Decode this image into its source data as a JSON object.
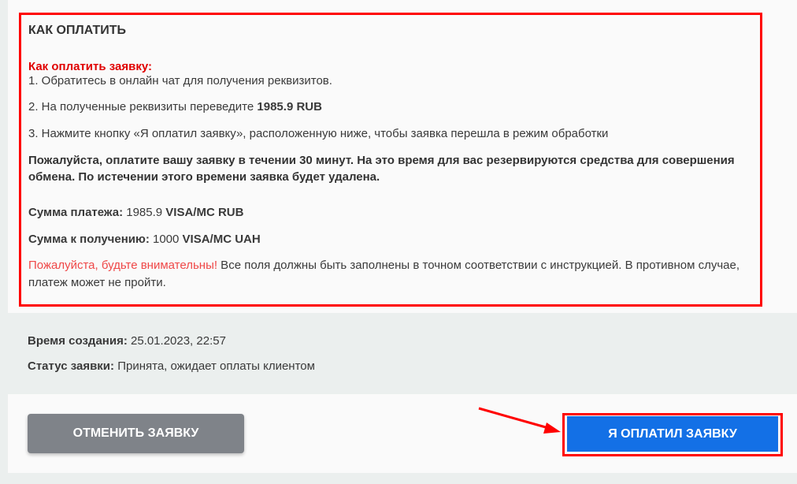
{
  "instructions": {
    "title": "КАК ОПЛАТИТЬ",
    "subtitle": "Как оплатить заявку:",
    "step1": "1. Обратитесь в онлайн чат для получения реквизитов.",
    "step2_prefix": "2. На полученные реквизиты переведите ",
    "step2_amount": "1985.9 RUB",
    "step3": "3. Нажмите кнопку «Я оплатил заявку», расположенную ниже, чтобы заявка перешла в режим обработки",
    "warning": "Пожалуйста, оплатите вашу заявку в течении 30 минут. На это время для вас резервируются средства для совершения обмена. По истечении этого времени заявка будет удалена.",
    "pay_label": "Сумма платежа:",
    "pay_amount": "1985.9",
    "pay_currency": "VISA/MC RUB",
    "receive_label": "Сумма к получению:",
    "receive_amount": "1000",
    "receive_currency": "VISA/MC UAH",
    "notice_red": "Пожалуйста, будьте внимательны!",
    "notice_text": " Все поля должны быть заполнены в точном соответствии с инструкцией. В противном случае, платеж может не пройти."
  },
  "meta": {
    "created_label": "Время создания:",
    "created_value": "25.01.2023, 22:57",
    "status_label": "Статус заявки:",
    "status_value": "Принята, ожидает оплаты клиентом"
  },
  "actions": {
    "cancel_label": "ОТМЕНИТЬ ЗАЯВКУ",
    "confirm_label": "Я ОПЛАТИЛ ЗАЯВКУ"
  },
  "colors": {
    "highlight": "#ff0000",
    "confirm_bg": "#1370e6",
    "cancel_bg": "#7f8389"
  }
}
